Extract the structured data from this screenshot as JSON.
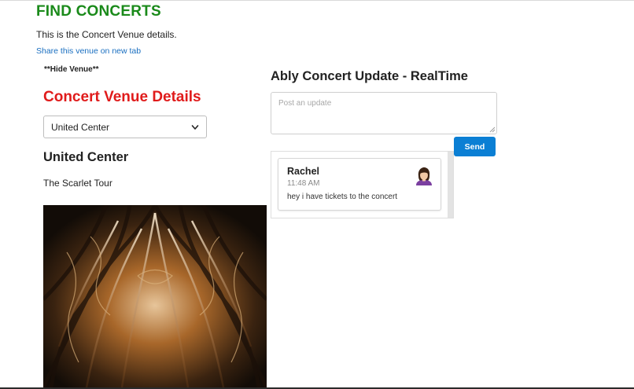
{
  "header": {
    "site_title": "FIND CONCERTS",
    "intro_text": "This is the Concert Venue details.",
    "share_link": "Share this venue on new tab",
    "hide_venue": "**Hide Venue**"
  },
  "venue": {
    "heading": "Concert Venue Details",
    "select_value": "United Center",
    "name": "United Center",
    "tour": "The Scarlet Tour"
  },
  "ably": {
    "title": "Ably Concert Update - RealTime",
    "input_placeholder": "Post an update",
    "send_label": "Send",
    "messages": [
      {
        "author": "Rachel",
        "time": "11:48 AM",
        "text": "hey i have tickets to the concert",
        "avatar_icon": "user-avatar-icon"
      }
    ]
  },
  "colors": {
    "site_title": "#1a8a1a",
    "venue_heading": "#e01b1b",
    "link": "#1a6fc0",
    "send_button": "#0b7fd4"
  }
}
